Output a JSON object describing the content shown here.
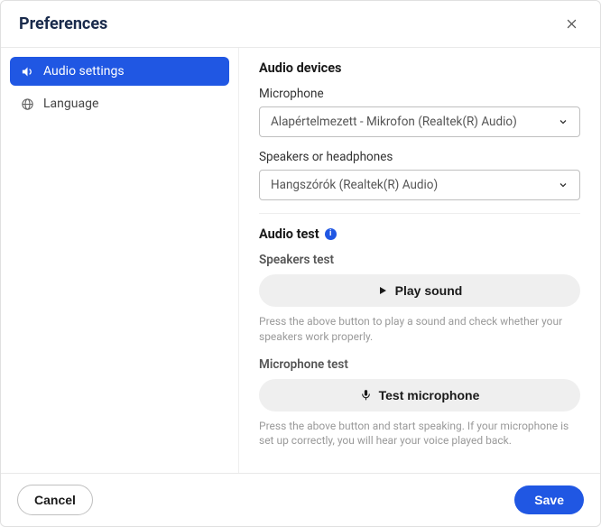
{
  "header": {
    "title": "Preferences"
  },
  "sidebar": {
    "items": [
      {
        "label": "Audio settings",
        "icon": "volume-icon",
        "active": true
      },
      {
        "label": "Language",
        "icon": "globe-icon",
        "active": false
      }
    ]
  },
  "content": {
    "audio_devices_title": "Audio devices",
    "microphone_label": "Microphone",
    "microphone_value": "Alapértelmezett - Mikrofon (Realtek(R) Audio)",
    "speakers_label": "Speakers or headphones",
    "speakers_value": "Hangszórók (Realtek(R) Audio)",
    "audio_test_title": "Audio test",
    "speakers_test_label": "Speakers test",
    "play_sound_label": "Play sound",
    "speakers_help": "Press the above button to play a sound and check whether your speakers work properly.",
    "mic_test_label": "Microphone test",
    "test_mic_label": "Test microphone",
    "mic_help": "Press the above button and start speaking. If your microphone is set up correctly, you will hear your voice played back."
  },
  "footer": {
    "cancel": "Cancel",
    "save": "Save"
  }
}
